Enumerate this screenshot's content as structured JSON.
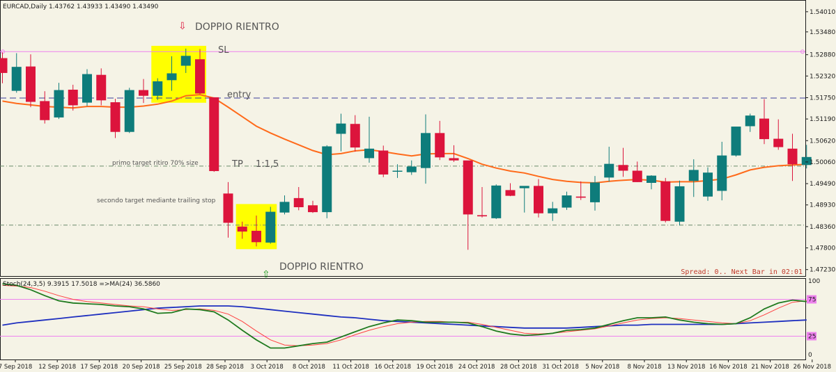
{
  "main_header": "EURCAD,Daily  1.43762 1.43933 1.43490 1.43490",
  "stoch_header": "Stoch(24,3,5) 9.3915 17.5018  =>MA(24) 36.5860",
  "status_text": "Spread: 0.. Next Bar in 02:01",
  "annotations": {
    "doppio_top": "DOPPIO RIENTRO",
    "doppio_bottom": "DOPPIO RIENTRO",
    "sl": "SL",
    "entry": "entry",
    "tp": "TP",
    "rr": "1:1,5",
    "primo": "primo target ritiro 70% size",
    "secondo": "secondo target mediante trailing stop",
    "arrow_down": "⇩",
    "arrow_up": "⇧"
  },
  "colors": {
    "background": "#f5f3e6",
    "bull": "#0e7c7b",
    "bear": "#dc143c",
    "ma": "#ff6a1a",
    "stoch_main": "#1f7a1f",
    "stoch_signal": "#ff4040",
    "stoch_ma": "#1e2fbf",
    "levels": "#ee82ee",
    "entry_line": "#3c3c9c",
    "highlight": "#ffff00",
    "text": "#555555"
  },
  "chart_data": {
    "type": "candlestick",
    "symbol": "EURCAD",
    "timeframe": "Daily",
    "y_ticks": [
      "1.54010",
      "1.53480",
      "1.52880",
      "1.52320",
      "1.51750",
      "1.51190",
      "1.50620",
      "1.50060",
      "1.49490",
      "1.48930",
      "1.48360",
      "1.47800",
      "1.47230"
    ],
    "y_range": [
      1.4706,
      1.543
    ],
    "x_ticks": [
      "7 Sep 2018",
      "12 Sep 2018",
      "17 Sep 2018",
      "20 Sep 2018",
      "25 Sep 2018",
      "28 Sep 2018",
      "3 Oct 2018",
      "8 Oct 2018",
      "11 Oct 2018",
      "16 Oct 2018",
      "19 Oct 2018",
      "24 Oct 2018",
      "28 Oct 2018",
      "31 Oct 2018",
      "5 Nov 2018",
      "8 Nov 2018",
      "13 Nov 2018",
      "16 Nov 2018",
      "21 Nov 2018",
      "26 Nov 2018"
    ],
    "levels": {
      "sl": 1.5296,
      "entry": 1.5174,
      "tp": 1.4995,
      "target2": 1.484
    },
    "candles": [
      {
        "o": 1.5279,
        "h": 1.5294,
        "l": 1.5213,
        "c": 1.524
      },
      {
        "o": 1.5193,
        "h": 1.5292,
        "l": 1.5188,
        "c": 1.5256
      },
      {
        "o": 1.5257,
        "h": 1.5289,
        "l": 1.515,
        "c": 1.5164
      },
      {
        "o": 1.5166,
        "h": 1.5192,
        "l": 1.5107,
        "c": 1.5116
      },
      {
        "o": 1.5123,
        "h": 1.5214,
        "l": 1.5119,
        "c": 1.5195
      },
      {
        "o": 1.5196,
        "h": 1.5209,
        "l": 1.5141,
        "c": 1.5155
      },
      {
        "o": 1.5162,
        "h": 1.525,
        "l": 1.5153,
        "c": 1.5237
      },
      {
        "o": 1.5235,
        "h": 1.5252,
        "l": 1.5155,
        "c": 1.5168
      },
      {
        "o": 1.5163,
        "h": 1.5172,
        "l": 1.5069,
        "c": 1.5085
      },
      {
        "o": 1.5085,
        "h": 1.5201,
        "l": 1.5082,
        "c": 1.5195
      },
      {
        "o": 1.5195,
        "h": 1.5224,
        "l": 1.5161,
        "c": 1.518
      },
      {
        "o": 1.518,
        "h": 1.5226,
        "l": 1.5169,
        "c": 1.5218
      },
      {
        "o": 1.5221,
        "h": 1.5284,
        "l": 1.5193,
        "c": 1.5239
      },
      {
        "o": 1.5259,
        "h": 1.5304,
        "l": 1.524,
        "c": 1.5285
      },
      {
        "o": 1.5276,
        "h": 1.5303,
        "l": 1.5184,
        "c": 1.5186
      },
      {
        "o": 1.5176,
        "h": 1.5176,
        "l": 1.498,
        "c": 1.4982
      },
      {
        "o": 1.4923,
        "h": 1.4953,
        "l": 1.4807,
        "c": 1.4846
      },
      {
        "o": 1.4836,
        "h": 1.4849,
        "l": 1.4804,
        "c": 1.4823
      },
      {
        "o": 1.4825,
        "h": 1.4865,
        "l": 1.4784,
        "c": 1.4795
      },
      {
        "o": 1.4794,
        "h": 1.4888,
        "l": 1.4791,
        "c": 1.4875
      },
      {
        "o": 1.4873,
        "h": 1.4918,
        "l": 1.4868,
        "c": 1.4901
      },
      {
        "o": 1.4911,
        "h": 1.494,
        "l": 1.4879,
        "c": 1.4887
      },
      {
        "o": 1.4892,
        "h": 1.4904,
        "l": 1.4872,
        "c": 1.4874
      },
      {
        "o": 1.4874,
        "h": 1.505,
        "l": 1.4858,
        "c": 1.5047
      },
      {
        "o": 1.508,
        "h": 1.5133,
        "l": 1.5034,
        "c": 1.5107
      },
      {
        "o": 1.5106,
        "h": 1.5129,
        "l": 1.5033,
        "c": 1.5044
      },
      {
        "o": 1.5016,
        "h": 1.5125,
        "l": 1.5004,
        "c": 1.5041
      },
      {
        "o": 1.5036,
        "h": 1.5049,
        "l": 1.4966,
        "c": 1.4973
      },
      {
        "o": 1.4983,
        "h": 1.5,
        "l": 1.4964,
        "c": 1.4983
      },
      {
        "o": 1.4979,
        "h": 1.501,
        "l": 1.4972,
        "c": 1.4994
      },
      {
        "o": 1.499,
        "h": 1.5131,
        "l": 1.4949,
        "c": 1.5082
      },
      {
        "o": 1.5082,
        "h": 1.5114,
        "l": 1.5011,
        "c": 1.5018
      },
      {
        "o": 1.5016,
        "h": 1.505,
        "l": 1.5006,
        "c": 1.501
      },
      {
        "o": 1.501,
        "h": 1.5009,
        "l": 1.4775,
        "c": 1.4868
      },
      {
        "o": 1.4866,
        "h": 1.494,
        "l": 1.486,
        "c": 1.4863
      },
      {
        "o": 1.4858,
        "h": 1.4947,
        "l": 1.4856,
        "c": 1.4944
      },
      {
        "o": 1.4932,
        "h": 1.495,
        "l": 1.4916,
        "c": 1.4917
      },
      {
        "o": 1.4937,
        "h": 1.4941,
        "l": 1.4873,
        "c": 1.4943
      },
      {
        "o": 1.4943,
        "h": 1.4961,
        "l": 1.486,
        "c": 1.4871
      },
      {
        "o": 1.4871,
        "h": 1.4901,
        "l": 1.4851,
        "c": 1.4884
      },
      {
        "o": 1.4886,
        "h": 1.4928,
        "l": 1.488,
        "c": 1.4918
      },
      {
        "o": 1.4915,
        "h": 1.4955,
        "l": 1.4906,
        "c": 1.4912
      },
      {
        "o": 1.49,
        "h": 1.4969,
        "l": 1.4878,
        "c": 1.4952
      },
      {
        "o": 1.4965,
        "h": 1.5046,
        "l": 1.4954,
        "c": 1.5001
      },
      {
        "o": 1.4998,
        "h": 1.5043,
        "l": 1.4967,
        "c": 1.4983
      },
      {
        "o": 1.4983,
        "h": 1.5007,
        "l": 1.4953,
        "c": 1.4953
      },
      {
        "o": 1.4951,
        "h": 1.4971,
        "l": 1.4934,
        "c": 1.497
      },
      {
        "o": 1.4955,
        "h": 1.4964,
        "l": 1.4847,
        "c": 1.4851
      },
      {
        "o": 1.4849,
        "h": 1.4957,
        "l": 1.4839,
        "c": 1.4942
      },
      {
        "o": 1.4956,
        "h": 1.5013,
        "l": 1.4914,
        "c": 1.4985
      },
      {
        "o": 1.4915,
        "h": 1.4992,
        "l": 1.4904,
        "c": 1.4978
      },
      {
        "o": 1.493,
        "h": 1.5059,
        "l": 1.4905,
        "c": 1.5023
      },
      {
        "o": 1.5023,
        "h": 1.5095,
        "l": 1.502,
        "c": 1.5099
      },
      {
        "o": 1.51,
        "h": 1.5133,
        "l": 1.5085,
        "c": 1.5128
      },
      {
        "o": 1.512,
        "h": 1.5171,
        "l": 1.5053,
        "c": 1.5066
      },
      {
        "o": 1.5067,
        "h": 1.5118,
        "l": 1.5038,
        "c": 1.5045
      },
      {
        "o": 1.5041,
        "h": 1.508,
        "l": 1.4956,
        "c": 1.5
      },
      {
        "o": 1.4998,
        "h": 1.5051,
        "l": 1.4989,
        "c": 1.5019
      }
    ],
    "ma_line": [
      1.5166,
      1.516,
      1.5156,
      1.5152,
      1.515,
      1.5148,
      1.5152,
      1.5152,
      1.515,
      1.515,
      1.5153,
      1.5158,
      1.5166,
      1.518,
      1.5183,
      1.5174,
      1.515,
      1.5125,
      1.51,
      1.5082,
      1.5066,
      1.5051,
      1.5036,
      1.5025,
      1.5028,
      1.5035,
      1.5038,
      1.5033,
      1.5027,
      1.5022,
      1.5027,
      1.5028,
      1.5028,
      1.5015,
      1.5,
      1.499,
      1.4982,
      1.4977,
      1.4968,
      1.496,
      1.4955,
      1.4952,
      1.4951,
      1.4955,
      1.4958,
      1.496,
      1.4958,
      1.4953,
      1.4954,
      1.4954,
      1.4957,
      1.4961,
      1.4972,
      1.4985,
      1.4992,
      1.4996,
      1.4998,
      1.5
    ],
    "stochastic": {
      "header": "Stoch(24,3,5) 9.3915 17.5018  =>MA(24) 36.5860",
      "y_ticks": [
        "100",
        "75",
        "25",
        "0"
      ],
      "y_range": [
        0,
        100
      ],
      "levels": [
        75,
        25
      ],
      "main": [
        96,
        94,
        88,
        80,
        73,
        70,
        69,
        68,
        66,
        65,
        62,
        56,
        57,
        62,
        61,
        58,
        47,
        33,
        20,
        9,
        9,
        12,
        15,
        17,
        24,
        31,
        38,
        43,
        47,
        46,
        44,
        44,
        44,
        43,
        38,
        32,
        28,
        26,
        27,
        29,
        33,
        34,
        36,
        41,
        46,
        50,
        50,
        51,
        47,
        44,
        42,
        41,
        42,
        50,
        62,
        70,
        74,
        72
      ],
      "signal": [
        94,
        93,
        91,
        86,
        80,
        75,
        72,
        70,
        68,
        66,
        65,
        62,
        60,
        61,
        62,
        60,
        55,
        45,
        32,
        20,
        13,
        12,
        13,
        15,
        20,
        27,
        33,
        38,
        42,
        44,
        45,
        45,
        44,
        44,
        41,
        37,
        33,
        29,
        28,
        29,
        31,
        33,
        35,
        39,
        43,
        47,
        49,
        50,
        49,
        47,
        45,
        43,
        42,
        46,
        54,
        63,
        71,
        73
      ],
      "ma": [
        40,
        43,
        45,
        47,
        49,
        51,
        53,
        55,
        57,
        59,
        61,
        63,
        64,
        65,
        66,
        66,
        66,
        65,
        63,
        61,
        59,
        57,
        55,
        53,
        51,
        50,
        48,
        46,
        45,
        44,
        43,
        42,
        41,
        40,
        39,
        38,
        37,
        36,
        36,
        36,
        36,
        37,
        38,
        39,
        40,
        40,
        41,
        41,
        41,
        41,
        41,
        41,
        42,
        43,
        44,
        45,
        46,
        47
      ]
    }
  }
}
